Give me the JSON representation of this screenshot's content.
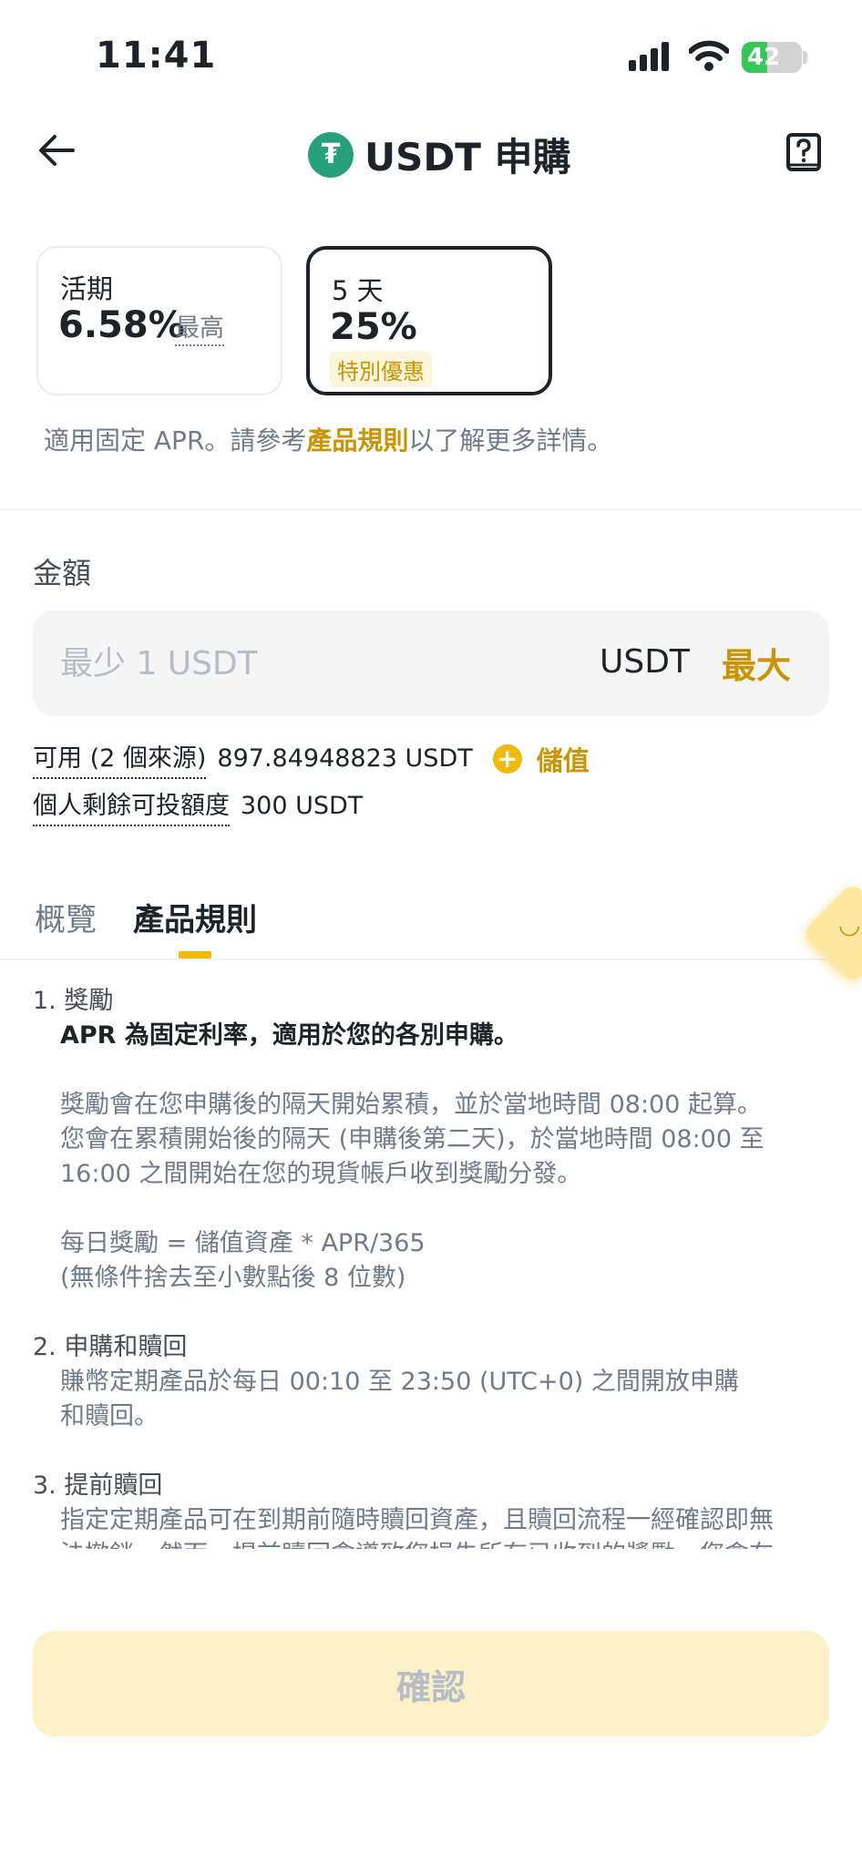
{
  "status_bar": {
    "time": "11:41",
    "battery": "42",
    "battery_level": 0.42
  },
  "header": {
    "title": "USDT 申購",
    "logo_glyph": "₮"
  },
  "terms": [
    {
      "label": "活期",
      "rate": "6.58%",
      "note": "最高"
    },
    {
      "label": "5 天",
      "rate": "25%",
      "badge": "特別優惠"
    }
  ],
  "apr_note": {
    "prefix": "適用固定 APR。請參考",
    "link": "產品規則",
    "suffix": "以了解更多詳情。"
  },
  "amount": {
    "label": "金額",
    "placeholder": "最少 1 USDT",
    "unit": "USDT",
    "max_label": "最大"
  },
  "available": {
    "label": "可用 (2 個來源)",
    "value": "897.84948823 USDT",
    "deposit_label": "儲值"
  },
  "quota": {
    "label": "個人剩餘可投額度",
    "value": "300 USDT"
  },
  "tabs": [
    {
      "label": "概覽"
    },
    {
      "label": "產品規則"
    }
  ],
  "rules": {
    "r1_title": "1. 獎勵",
    "r1_strong": "APR 為固定利率，適用於您的各別申購。",
    "r1_p1_l1": "獎勵會在您申購後的隔天開始累積，並於當地時間 08:00 起算。",
    "r1_p1_l2": "您會在累積開始後的隔天 (申購後第二天)，於當地時間 08:00 至",
    "r1_p1_l3": "16:00 之間開始在您的現貨帳戶收到獎勵分發。",
    "r1_p2_l1": "每日獎勵 = 儲值資產 * APR/365",
    "r1_p2_l2": "(無條件捨去至小數點後 8 位數)",
    "r2_title": "2. 申購和贖回",
    "r2_l1": "賺幣定期產品於每日 00:10 至 23:50 (UTC+0) 之間開放申購",
    "r2_l2": "和贖回。",
    "r3_title": "3. 提前贖回",
    "r3_l1": "指定定期產品可在到期前隨時贖回資產，且贖回流程一經確認即無",
    "r3_l2": "法撤銷。然而，提前贖回會導致您損失所有已收到的獎勵，您會在"
  },
  "confirm_label": "確認",
  "colors": {
    "accent": "#f0b90b",
    "accent_text": "#c99400",
    "tether": "#26a17b"
  }
}
